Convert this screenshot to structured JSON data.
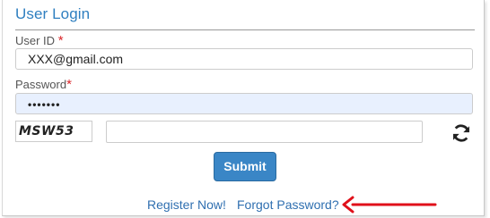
{
  "form": {
    "title": "User Login",
    "user_id": {
      "label": "User ID",
      "required_mark": "*",
      "value": "XXX@gmail.com"
    },
    "password": {
      "label": "Password",
      "required_mark": "*",
      "masked_value": "•••••••"
    },
    "captcha": {
      "image_text": "MSW53",
      "input_value": "",
      "refresh_icon": "refresh-icon"
    },
    "submit_label": "Submit"
  },
  "links": {
    "register": "Register Now!",
    "forgot_password": "Forgot Password?"
  },
  "annotation": {
    "arrow_color": "#e0101a",
    "arrow_icon": "left-arrow-icon"
  },
  "colors": {
    "title": "#2f7fc0",
    "required": "#d9262a",
    "button": "#3a86c6",
    "link": "#2f6fb0",
    "autofill": "#e8f0fe"
  }
}
